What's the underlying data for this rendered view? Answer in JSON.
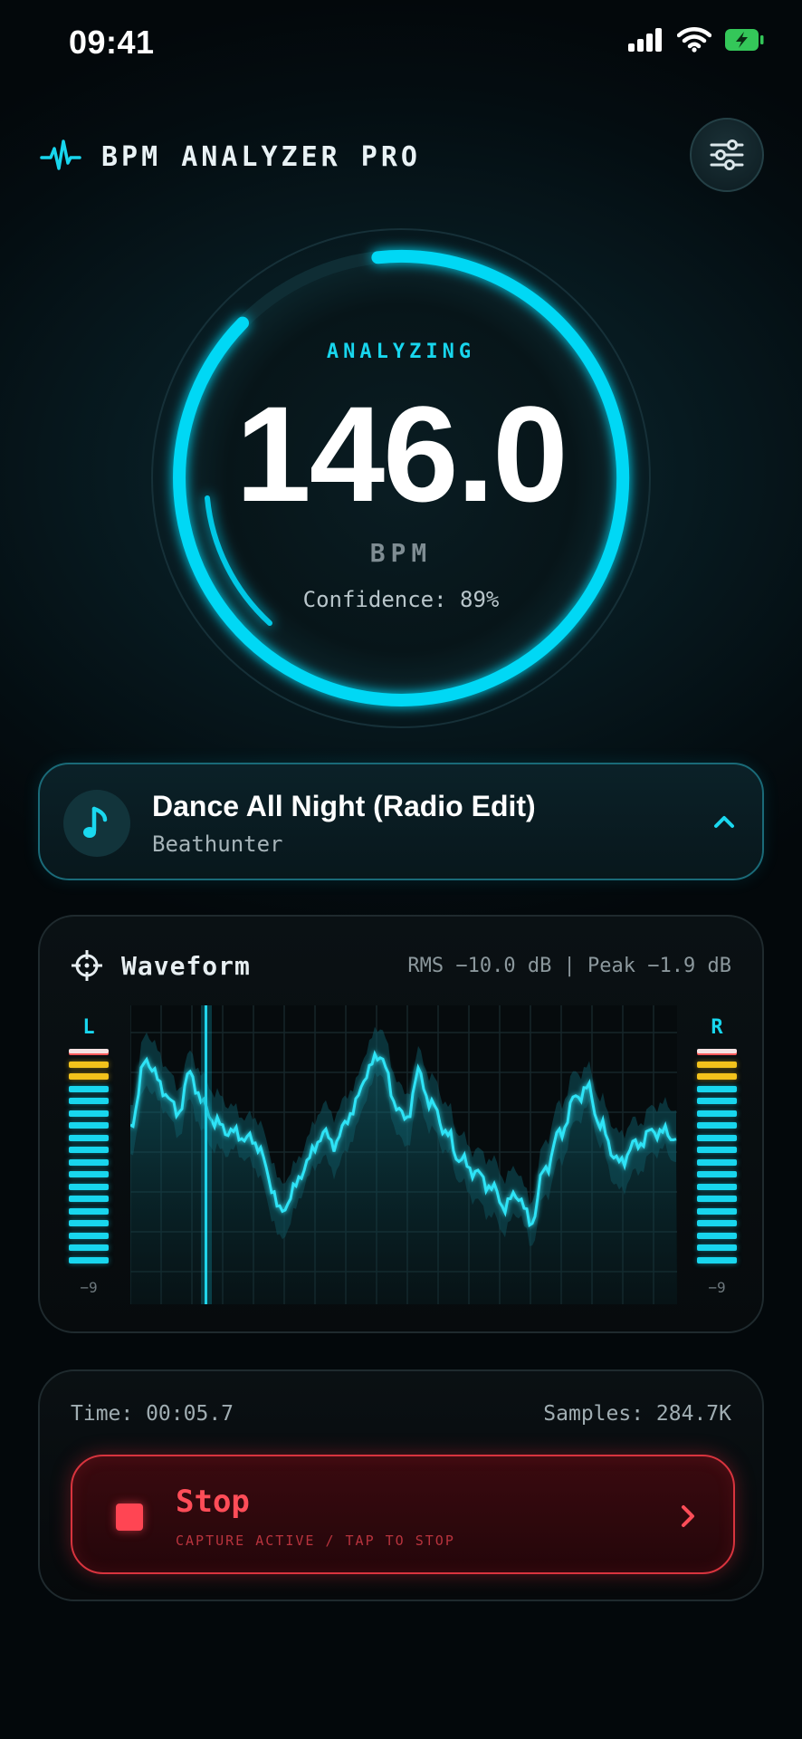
{
  "status_bar": {
    "time": "09:41",
    "icons": [
      "cellular-signal-icon",
      "wifi-icon",
      "battery-charging-icon"
    ]
  },
  "header": {
    "icon": "pulse-waveform-icon",
    "title": "BPM ANALYZER PRO",
    "settings_icon": "sliders-icon"
  },
  "gauge": {
    "status": "ANALYZING",
    "value": "146.0",
    "unit": "BPM",
    "confidence_label": "Confidence: 89%",
    "confidence_fraction": 0.89
  },
  "track": {
    "icon": "music-note-icon",
    "title": "Dance All Night (Radio Edit)",
    "artist": "Beathunter",
    "expand_icon": "chevron-up-icon"
  },
  "waveform": {
    "icon": "crosshair-icon",
    "title": "Waveform",
    "stats": "RMS −10.0 dB | Peak −1.9 dB",
    "left_label": "L",
    "right_label": "R",
    "left_scale": "−9",
    "right_scale": "−9",
    "left_level": 1.0,
    "right_level": 1.0
  },
  "capture": {
    "time_label": "Time: 00:05.7",
    "samples_label": "Samples: 284.7K",
    "stop_label": "Stop",
    "stop_sublabel": "CAPTURE ACTIVE / TAP TO STOP",
    "stop_icon": "stop-square-icon",
    "chevron_icon": "chevron-right-icon"
  },
  "colors": {
    "accent": "#18d6ee",
    "danger": "#ff4553",
    "meter_warn": "#f3c21b",
    "meter_peak": "#ff5a5a",
    "battery": "#34c759"
  }
}
